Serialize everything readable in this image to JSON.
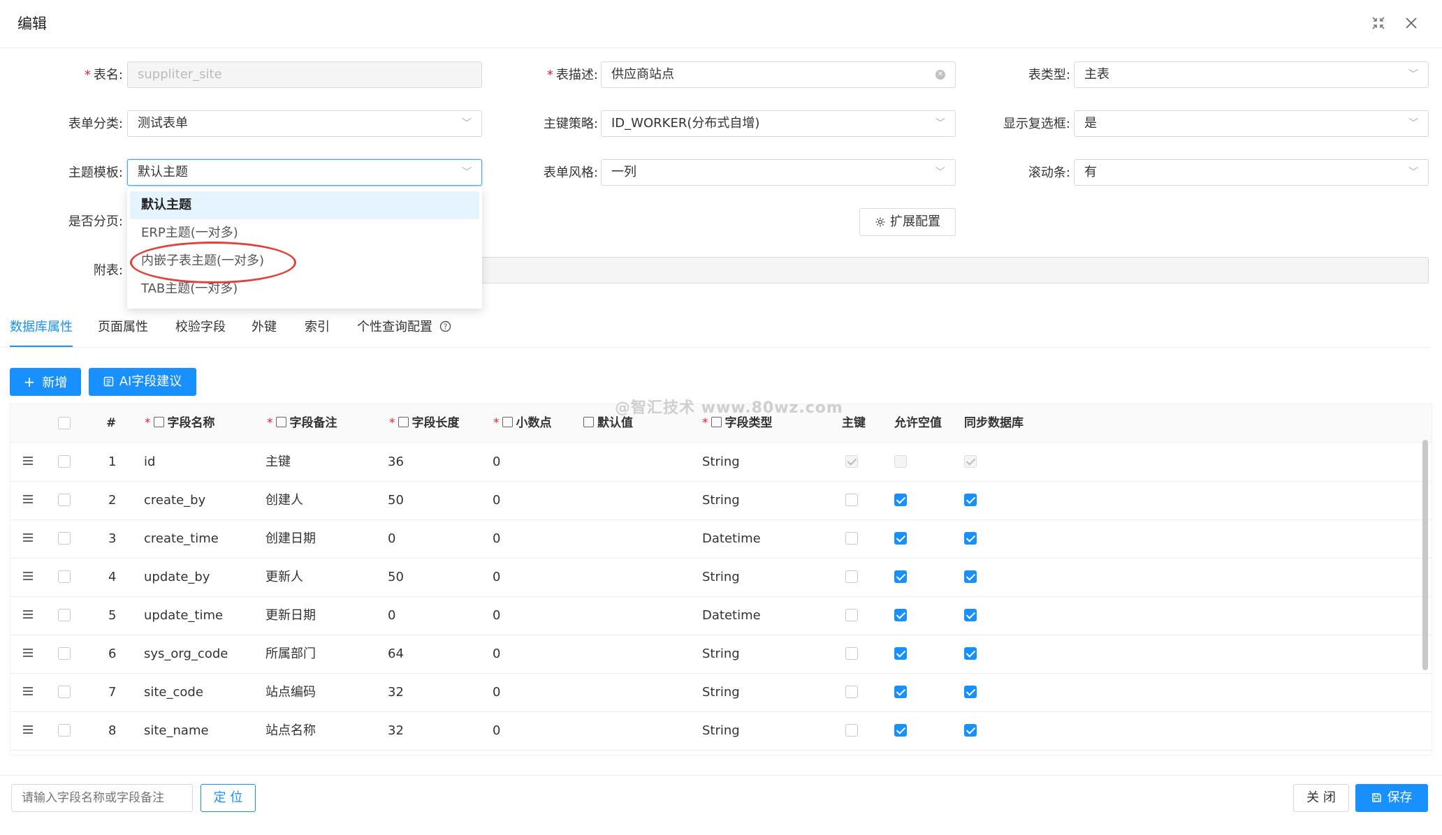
{
  "modal": {
    "title": "编辑"
  },
  "form": {
    "table_name": {
      "label": "表名:",
      "value": "suppliter_site"
    },
    "table_desc": {
      "label": "表描述:",
      "value": "供应商站点"
    },
    "table_type": {
      "label": "表类型:",
      "value": "主表"
    },
    "form_category": {
      "label": "表单分类:",
      "value": "测试表单"
    },
    "pk_strategy": {
      "label": "主键策略:",
      "value": "ID_WORKER(分布式自增)"
    },
    "show_checkbox": {
      "label": "显示复选框:",
      "value": "是"
    },
    "theme_template": {
      "label": "主题模板:",
      "value": "默认主题"
    },
    "form_style": {
      "label": "表单风格:",
      "value": "一列"
    },
    "scrollbar": {
      "label": "滚动条:",
      "value": "有"
    },
    "paging": {
      "label": "是否分页:"
    },
    "ext_config_label": "扩展配置",
    "sub_table": {
      "label": "附表:"
    }
  },
  "dropdown": {
    "options": [
      "默认主题",
      "ERP主题(一对多)",
      "内嵌子表主题(一对多)",
      "TAB主题(一对多)"
    ],
    "selected": 0,
    "highlighted": 2
  },
  "tabs": [
    "数据库属性",
    "页面属性",
    "校验字段",
    "外键",
    "索引",
    "个性查询配置"
  ],
  "toolbar": {
    "add_label": "新增",
    "ai_label": "AI字段建议"
  },
  "watermark": "@智汇技术 www.80wz.com",
  "table": {
    "headers": {
      "num": "#",
      "name": "字段名称",
      "remark": "字段备注",
      "length": "字段长度",
      "decimal": "小数点",
      "default": "默认值",
      "type": "字段类型",
      "pk": "主键",
      "nullable": "允许空值",
      "sync": "同步数据库"
    },
    "rows": [
      {
        "num": "1",
        "name": "id",
        "remark": "主键",
        "length": "36",
        "decimal": "0",
        "default": "",
        "type": "String",
        "pk": true,
        "nullable": false,
        "sync": true
      },
      {
        "num": "2",
        "name": "create_by",
        "remark": "创建人",
        "length": "50",
        "decimal": "0",
        "default": "",
        "type": "String",
        "pk": false,
        "nullable": true,
        "sync": true
      },
      {
        "num": "3",
        "name": "create_time",
        "remark": "创建日期",
        "length": "0",
        "decimal": "0",
        "default": "",
        "type": "Datetime",
        "pk": false,
        "nullable": true,
        "sync": true
      },
      {
        "num": "4",
        "name": "update_by",
        "remark": "更新人",
        "length": "50",
        "decimal": "0",
        "default": "",
        "type": "String",
        "pk": false,
        "nullable": true,
        "sync": true
      },
      {
        "num": "5",
        "name": "update_time",
        "remark": "更新日期",
        "length": "0",
        "decimal": "0",
        "default": "",
        "type": "Datetime",
        "pk": false,
        "nullable": true,
        "sync": true
      },
      {
        "num": "6",
        "name": "sys_org_code",
        "remark": "所属部门",
        "length": "64",
        "decimal": "0",
        "default": "",
        "type": "String",
        "pk": false,
        "nullable": true,
        "sync": true
      },
      {
        "num": "7",
        "name": "site_code",
        "remark": "站点编码",
        "length": "32",
        "decimal": "0",
        "default": "",
        "type": "String",
        "pk": false,
        "nullable": true,
        "sync": true
      },
      {
        "num": "8",
        "name": "site_name",
        "remark": "站点名称",
        "length": "32",
        "decimal": "0",
        "default": "",
        "type": "String",
        "pk": false,
        "nullable": true,
        "sync": true
      }
    ]
  },
  "footer": {
    "search_placeholder": "请输入字段名称或字段备注",
    "locate_label": "定 位",
    "close_label": "关 闭",
    "save_label": "保存"
  },
  "colors": {
    "primary": "#1890ff",
    "required": "#f5222d",
    "annotation": "#e0413a"
  }
}
